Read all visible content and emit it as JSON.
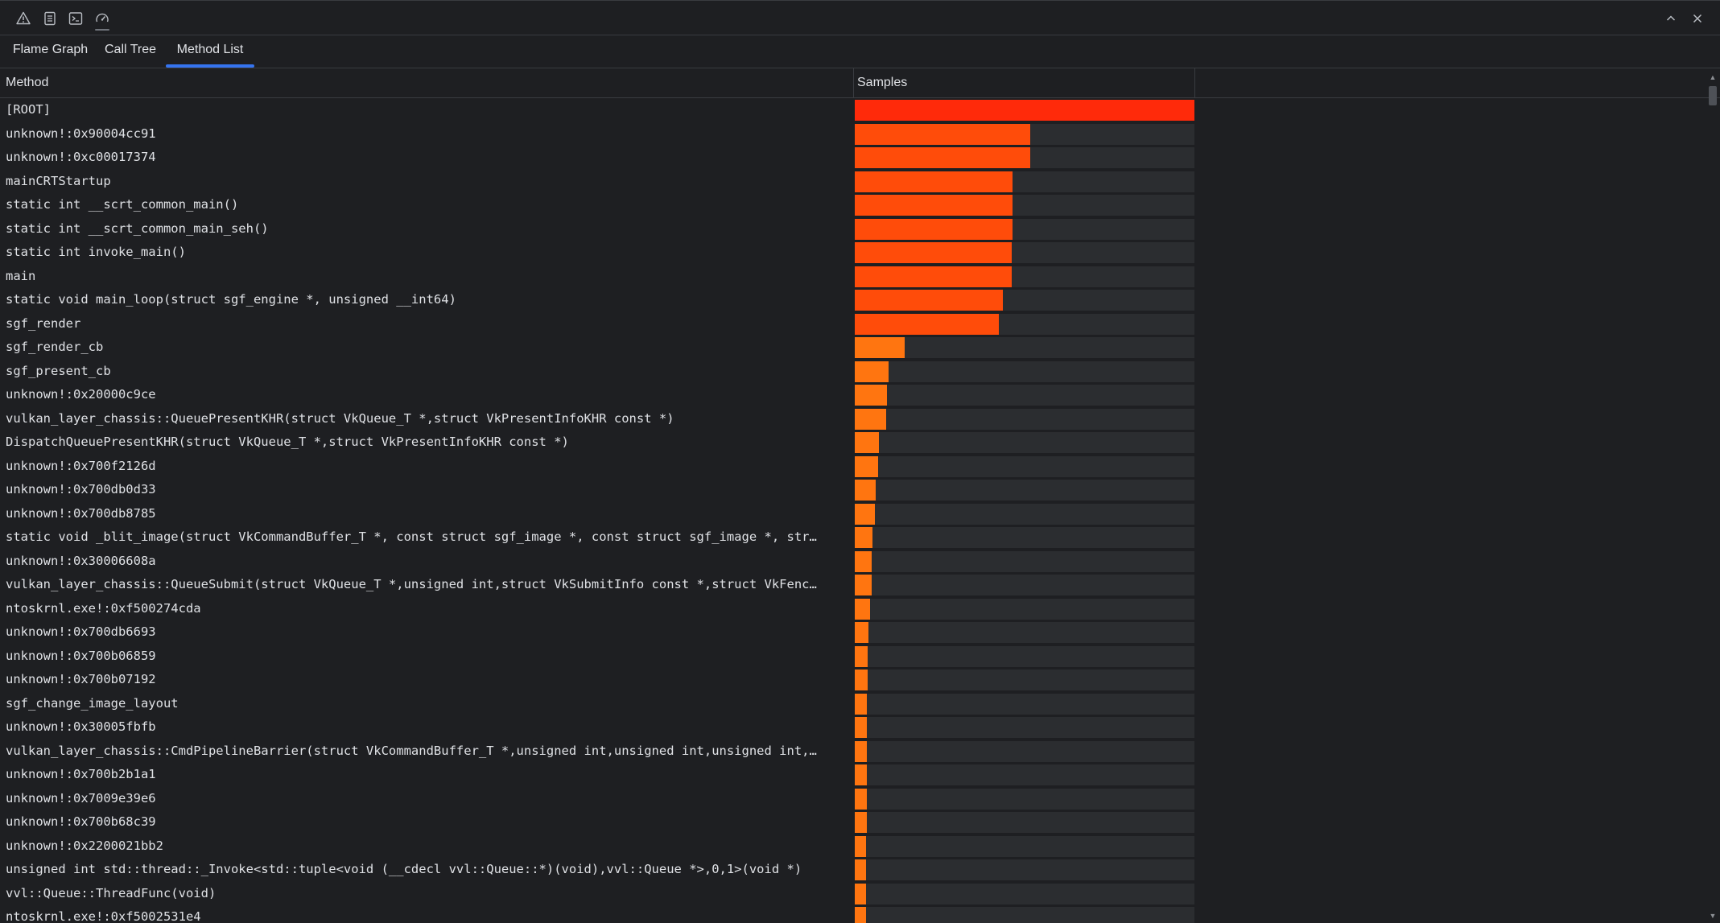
{
  "toolbar": {
    "icons": [
      "warning-icon",
      "notes-icon",
      "terminal-icon",
      "gauge-icon"
    ],
    "active_icon": "gauge-icon",
    "minimize_icon": "chevron-up-icon",
    "close_icon": "close-icon"
  },
  "tabs": [
    {
      "label": "Flame Graph",
      "active": false
    },
    {
      "label": "Call Tree",
      "active": false
    },
    {
      "label": "Method List",
      "active": true
    }
  ],
  "table": {
    "columns": {
      "method": "Method",
      "samples": "Samples"
    },
    "rows": [
      {
        "method": "[ROOT]",
        "fraction": 1.0
      },
      {
        "method": "unknown!:0x90004cc91",
        "fraction": 0.516
      },
      {
        "method": "unknown!:0xc00017374",
        "fraction": 0.516
      },
      {
        "method": "mainCRTStartup",
        "fraction": 0.464
      },
      {
        "method": "static int __scrt_common_main()",
        "fraction": 0.464
      },
      {
        "method": "static int __scrt_common_main_seh()",
        "fraction": 0.464
      },
      {
        "method": "static int invoke_main()",
        "fraction": 0.462
      },
      {
        "method": "main",
        "fraction": 0.462
      },
      {
        "method": "static void main_loop(struct sgf_engine *, unsigned __int64)",
        "fraction": 0.436
      },
      {
        "method": "sgf_render",
        "fraction": 0.424
      },
      {
        "method": "sgf_render_cb",
        "fraction": 0.146
      },
      {
        "method": "sgf_present_cb",
        "fraction": 0.1
      },
      {
        "method": "unknown!:0x20000c9ce",
        "fraction": 0.095
      },
      {
        "method": "vulkan_layer_chassis::QueuePresentKHR(struct VkQueue_T *,struct VkPresentInfoKHR const *)",
        "fraction": 0.093
      },
      {
        "method": "DispatchQueuePresentKHR(struct VkQueue_T *,struct VkPresentInfoKHR const *)",
        "fraction": 0.072
      },
      {
        "method": "unknown!:0x700f2126d",
        "fraction": 0.068
      },
      {
        "method": "unknown!:0x700db0d33",
        "fraction": 0.062
      },
      {
        "method": "unknown!:0x700db8785",
        "fraction": 0.06
      },
      {
        "method": "static void _blit_image(struct VkCommandBuffer_T *, const struct sgf_image *, const struct sgf_image *, str…",
        "fraction": 0.053
      },
      {
        "method": "unknown!:0x30006608a",
        "fraction": 0.05
      },
      {
        "method": "vulkan_layer_chassis::QueueSubmit(struct VkQueue_T *,unsigned int,struct VkSubmitInfo const *,struct VkFenc…",
        "fraction": 0.05
      },
      {
        "method": "ntoskrnl.exe!:0xf500274cda",
        "fraction": 0.045
      },
      {
        "method": "unknown!:0x700db6693",
        "fraction": 0.04
      },
      {
        "method": "unknown!:0x700b06859",
        "fraction": 0.038
      },
      {
        "method": "unknown!:0x700b07192",
        "fraction": 0.038
      },
      {
        "method": "sgf_change_image_layout",
        "fraction": 0.036
      },
      {
        "method": "unknown!:0x30005fbfb",
        "fraction": 0.036
      },
      {
        "method": "vulkan_layer_chassis::CmdPipelineBarrier(struct VkCommandBuffer_T *,unsigned int,unsigned int,unsigned int,…",
        "fraction": 0.036
      },
      {
        "method": "unknown!:0x700b2b1a1",
        "fraction": 0.036
      },
      {
        "method": "unknown!:0x7009e39e6",
        "fraction": 0.036
      },
      {
        "method": "unknown!:0x700b68c39",
        "fraction": 0.036
      },
      {
        "method": "unknown!:0x2200021bb2",
        "fraction": 0.034
      },
      {
        "method": "unsigned int std::thread::_Invoke<std::tuple<void (__cdecl vvl::Queue::*)(void),vvl::Queue *>,0,1>(void *)",
        "fraction": 0.034
      },
      {
        "method": "vvl::Queue::ThreadFunc(void)",
        "fraction": 0.034
      },
      {
        "method": "ntoskrnl.exe!:0xf5002531e4",
        "fraction": 0.034
      }
    ]
  },
  "colors": {
    "bar_hot": "#ff2a0a",
    "bar_warm": "#ff4c0a",
    "bar_mild": "#ff7510",
    "track": "#2b2d30",
    "accent": "#3574f0"
  }
}
